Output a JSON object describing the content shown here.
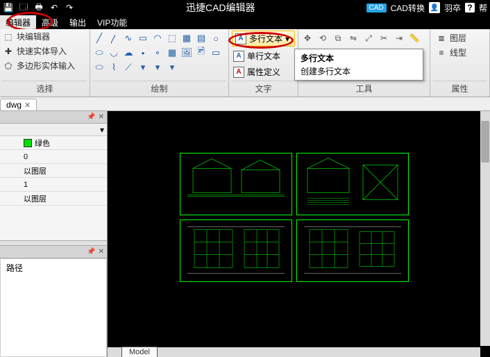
{
  "titlebar": {
    "app_title": "迅捷CAD编辑器",
    "convert_label": "CAD转换",
    "cad_badge": "CAD",
    "user_name": "羽卒",
    "help_icon": "?",
    "help_label": "帮"
  },
  "menubar": {
    "items": [
      "编辑器",
      "高级",
      "输出",
      "VIP功能"
    ],
    "active_index": 0
  },
  "ribbon": {
    "select_panel": {
      "label": "选择",
      "block_editor": "块编辑器",
      "fast_input": "快速实体导入",
      "poly_input": "多边形实体输入"
    },
    "draw_panel": {
      "label": "绘制"
    },
    "text_panel": {
      "label": "文字",
      "mtext_label": "多行文本",
      "single_text_label": "单行文本",
      "attrib_def_label": "属性定义"
    },
    "tool_panel": {
      "label": "工具"
    },
    "prop_panel": {
      "label": "属性",
      "layer_label": "图层",
      "linetype_label": "线型"
    }
  },
  "tooltip": {
    "title": "多行文本",
    "desc": "创建多行文本"
  },
  "doc_tab": {
    "name": "dwg"
  },
  "props": {
    "rows": [
      {
        "k": "",
        "v": "绿色",
        "swatch": true
      },
      {
        "k": "",
        "v": "0"
      },
      {
        "k": "",
        "v": "以图层"
      },
      {
        "k": "",
        "v": "1"
      },
      {
        "k": "",
        "v": "以图层"
      }
    ]
  },
  "panel2": {
    "path_label": "路径"
  },
  "canvas": {
    "model_tab": "Model"
  }
}
